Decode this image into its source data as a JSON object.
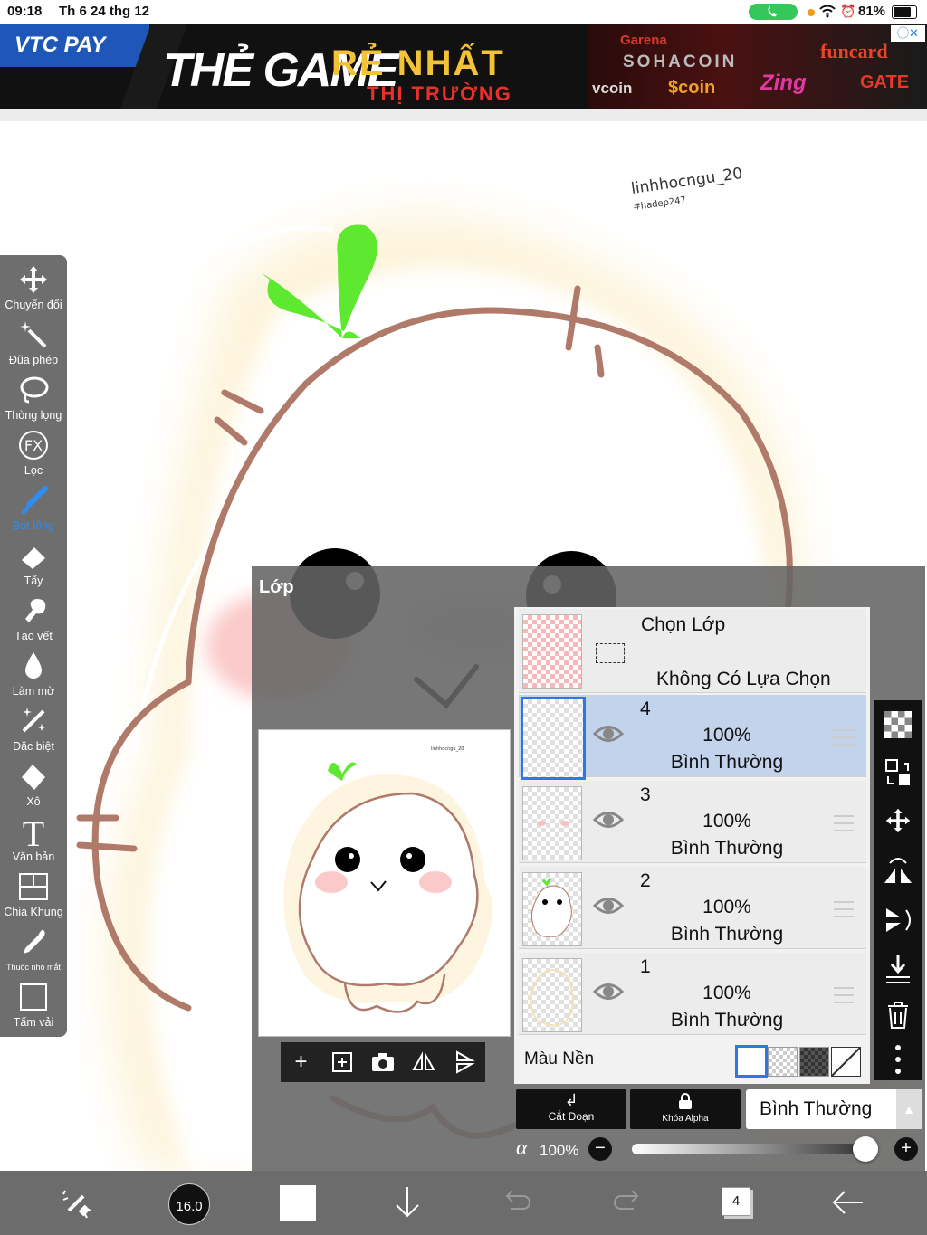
{
  "status_bar": {
    "time": "09:18",
    "date": "Th 6 24 thg 12",
    "battery": "81%"
  },
  "ad": {
    "logo": "VTC PAY",
    "headline": "THẺ GAME",
    "slogan": "RẺ NHẤT",
    "slogan_sub": "THỊ TRƯỜNG",
    "brands": [
      "Garena",
      "SOHACOIN",
      "funcard",
      "vcoin",
      "$coin",
      "Zing",
      "GATE"
    ],
    "close_label": "ⓘ✕"
  },
  "canvas": {
    "signature": "linhhocngu_20",
    "signature_sub": "#hadep247"
  },
  "toolbar": {
    "tools": [
      {
        "label": "Chuyển đổi",
        "icon": "move-icon"
      },
      {
        "label": "Đũa phép",
        "icon": "magic-wand-icon"
      },
      {
        "label": "Thòng lọng",
        "icon": "lasso-icon"
      },
      {
        "label": "Lọc",
        "icon": "fx-icon"
      },
      {
        "label": "Bút lông",
        "icon": "brush-icon"
      },
      {
        "label": "Tẩy",
        "icon": "eraser-icon"
      },
      {
        "label": "Tạo vết",
        "icon": "smudge-icon"
      },
      {
        "label": "Làm mờ",
        "icon": "blur-icon"
      },
      {
        "label": "Đặc biệt",
        "icon": "special-icon"
      },
      {
        "label": "Xô",
        "icon": "bucket-icon"
      },
      {
        "label": "Văn bản",
        "icon": "text-icon"
      },
      {
        "label": "Chia Khung",
        "icon": "frame-icon"
      },
      {
        "label": "Thuốc nhỏ mắt",
        "icon": "eyedropper-icon"
      },
      {
        "label": "Tấm vải",
        "icon": "canvas-icon"
      }
    ],
    "active_index": 4
  },
  "layer_panel": {
    "title": "Lớp",
    "selection": {
      "title": "Chọn Lớp",
      "status": "Không Có Lựa Chọn"
    },
    "layers": [
      {
        "number": "4",
        "opacity": "100%",
        "mode": "Bình Thường",
        "selected": true
      },
      {
        "number": "3",
        "opacity": "100%",
        "mode": "Bình Thường",
        "selected": false
      },
      {
        "number": "2",
        "opacity": "100%",
        "mode": "Bình Thường",
        "selected": false
      },
      {
        "number": "1",
        "opacity": "100%",
        "mode": "Bình Thường",
        "selected": false
      }
    ],
    "background_label": "Màu Nền",
    "clip_label": "Cắt Đoạn",
    "alpha_lock_label": "Khóa Alpha",
    "blend_mode": "Bình Thường",
    "alpha_symbol": "α",
    "alpha_value": "100%",
    "alpha_fraction": 1.0
  },
  "bottom_bar": {
    "brush_size": "16.0",
    "layer_count": "4"
  },
  "colors": {
    "accent": "#2f77e8",
    "panel": "#646464",
    "toolbar": "#6e6e6e",
    "sprout": "#5ee82f",
    "outline": "#b07a6a"
  }
}
